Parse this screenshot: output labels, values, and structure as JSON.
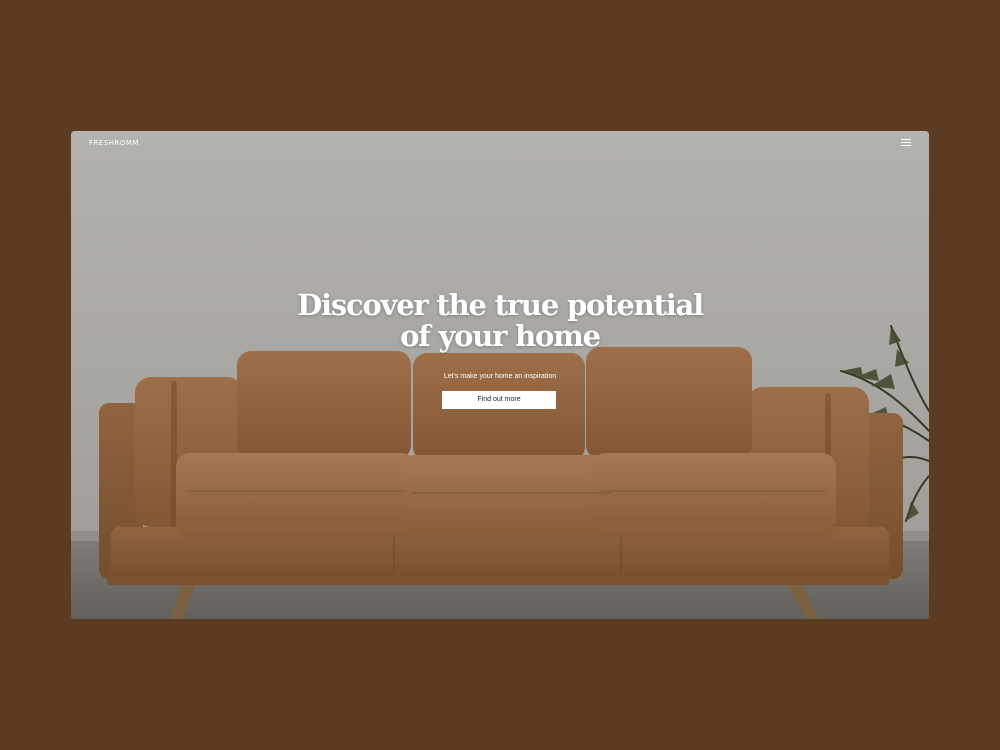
{
  "header": {
    "brand": "FRESHROMM",
    "menu_icon": "hamburger-menu-icon"
  },
  "hero": {
    "headline_line1": "Discover the true potential",
    "headline_line2": "of your home",
    "subheadline": "Let's make your home an inspiration",
    "cta_label": "Find out more"
  },
  "colors": {
    "page_background": "#5c3b23",
    "wall": "#c6c3be",
    "sofa_leather": "#a06e45",
    "text": "#ffffff",
    "button_background": "#ffffff",
    "button_text": "#1e1e1e"
  }
}
